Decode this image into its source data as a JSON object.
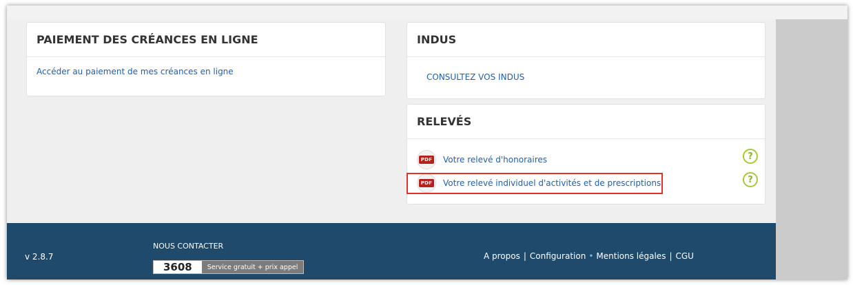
{
  "paiement": {
    "title": "PAIEMENT DES CRÉANCES EN LIGNE",
    "link": "Accéder au paiement de mes créances en ligne"
  },
  "indus": {
    "title": "INDUS",
    "link": "CONSULTEZ VOS INDUS"
  },
  "releves": {
    "title": "RELEVÉS",
    "items": [
      {
        "badge": "PDF",
        "label": "Votre relevé d'honoraires",
        "help": "?"
      },
      {
        "badge": "PDF",
        "label": "Votre relevé individuel d'activités et de prescriptions",
        "help": "?"
      }
    ]
  },
  "footer": {
    "version": "v 2.8.7",
    "contact_title": "NOUS CONTACTER",
    "phone": "3608",
    "phone_note": "Service gratuit + prix appel",
    "links": [
      "A propos",
      "Configuration",
      "Mentions légales",
      "CGU"
    ],
    "separators": [
      "|",
      "•",
      "|"
    ]
  },
  "colors": {
    "link": "#1f5fa8",
    "footer_bg": "#1f4a6b",
    "pdf_badge": "#b5211d",
    "help_icon": "#a6c93a",
    "highlight": "#e0312b"
  }
}
